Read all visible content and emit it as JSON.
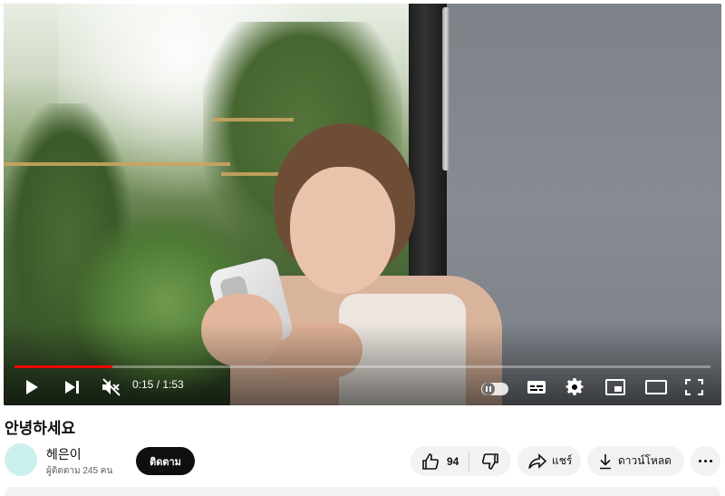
{
  "video": {
    "title": "안녕하세요",
    "progress": 0.14,
    "time_display": "0:15 / 1:53",
    "colors": {
      "progress": "#ff0000"
    }
  },
  "player_controls": {
    "icons": [
      "play-icon",
      "next-icon",
      "mute-icon",
      "autoplay-icon",
      "subtitles-icon",
      "settings-icon",
      "miniplayer-icon",
      "theater-mode-icon",
      "fullscreen-icon"
    ]
  },
  "channel": {
    "name": "헤은이",
    "subscribers": "ผู้ติดตาม 245 คน",
    "avatar_color": "#ccf0ee"
  },
  "actions": {
    "subscribe_label": "ติดตาม",
    "like_count": "94",
    "share_label": "แชร์",
    "download_label": "ดาวน์โหลด"
  }
}
